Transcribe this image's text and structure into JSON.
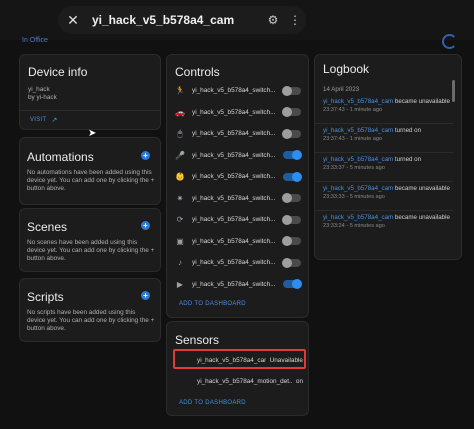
{
  "header": {
    "close_icon": "close-icon",
    "title": "yi_hack_v5_b578a4_cam",
    "gear_icon": "gear-icon",
    "menu_icon": "kebab-menu-icon"
  },
  "area_link": "In Office",
  "device_info": {
    "title": "Device info",
    "model": "yi_hack",
    "manufacturer": "by yi-hack",
    "visit_label": "VISIT"
  },
  "automations": {
    "title": "Automations",
    "text": "No automations have been added using this device yet. You can add one by clicking the + button above."
  },
  "scenes": {
    "title": "Scenes",
    "text": "No scenes have been added using this device yet. You can add one by clicking the + button above."
  },
  "scripts": {
    "title": "Scripts",
    "text": "No scripts have been added using this device yet. You can add one by clicking the + button above."
  },
  "controls": {
    "title": "Controls",
    "items": [
      {
        "icon": "motion-icon",
        "label": "yi_hack_v5_b578a4_switch...",
        "on": false
      },
      {
        "icon": "car-icon",
        "label": "yi_hack_v5_b578a4_switch...",
        "on": false
      },
      {
        "icon": "mouse-icon",
        "label": "yi_hack_v5_b578a4_switch...",
        "on": false
      },
      {
        "icon": "microphone-icon",
        "label": "yi_hack_v5_b578a4_switch...",
        "on": true
      },
      {
        "icon": "baby-icon",
        "label": "yi_hack_v5_b578a4_switch...",
        "on": true
      },
      {
        "icon": "light-icon",
        "label": "yi_hack_v5_b578a4_switch...",
        "on": false
      },
      {
        "icon": "rotate-icon",
        "label": "yi_hack_v5_b578a4_switch...",
        "on": false
      },
      {
        "icon": "save-icon",
        "label": "yi_hack_v5_b578a4_switch...",
        "on": false
      },
      {
        "icon": "music-icon",
        "label": "yi_hack_v5_b578a4_switch...",
        "on": false
      },
      {
        "icon": "video-icon",
        "label": "yi_hack_v5_b578a4_switch...",
        "on": true
      }
    ],
    "add_label": "ADD TO DASHBOARD"
  },
  "sensors": {
    "title": "Sensors",
    "items": [
      {
        "label": "yi_hack_v5_b578a4_cam",
        "value": "Unavailable"
      },
      {
        "label": "yi_hack_v5_b578a4_motion_det...",
        "value": "on"
      }
    ],
    "add_label": "ADD TO DASHBOARD"
  },
  "logbook": {
    "title": "Logbook",
    "date": "14 April 2023",
    "entries": [
      {
        "entity": "yi_hack_v5_b578a4_cam",
        "action": " became unavailable",
        "time": "23:37:43 - 1 minute ago"
      },
      {
        "entity": "yi_hack_v5_b578a4_cam",
        "action": " turned on",
        "time": "23:37:43 - 1 minute ago"
      },
      {
        "entity": "yi_hack_v5_b578a4_cam",
        "action": " turned on",
        "time": "23:33:37 - 5 minutes ago"
      },
      {
        "entity": "yi_hack_v5_b578a4_cam",
        "action": " became unavailable",
        "time": "23:33:33 - 5 minutes ago"
      },
      {
        "entity": "yi_hack_v5_b578a4_cam",
        "action": " became unavailable",
        "time": "23:33:24 - 5 minutes ago"
      }
    ]
  }
}
